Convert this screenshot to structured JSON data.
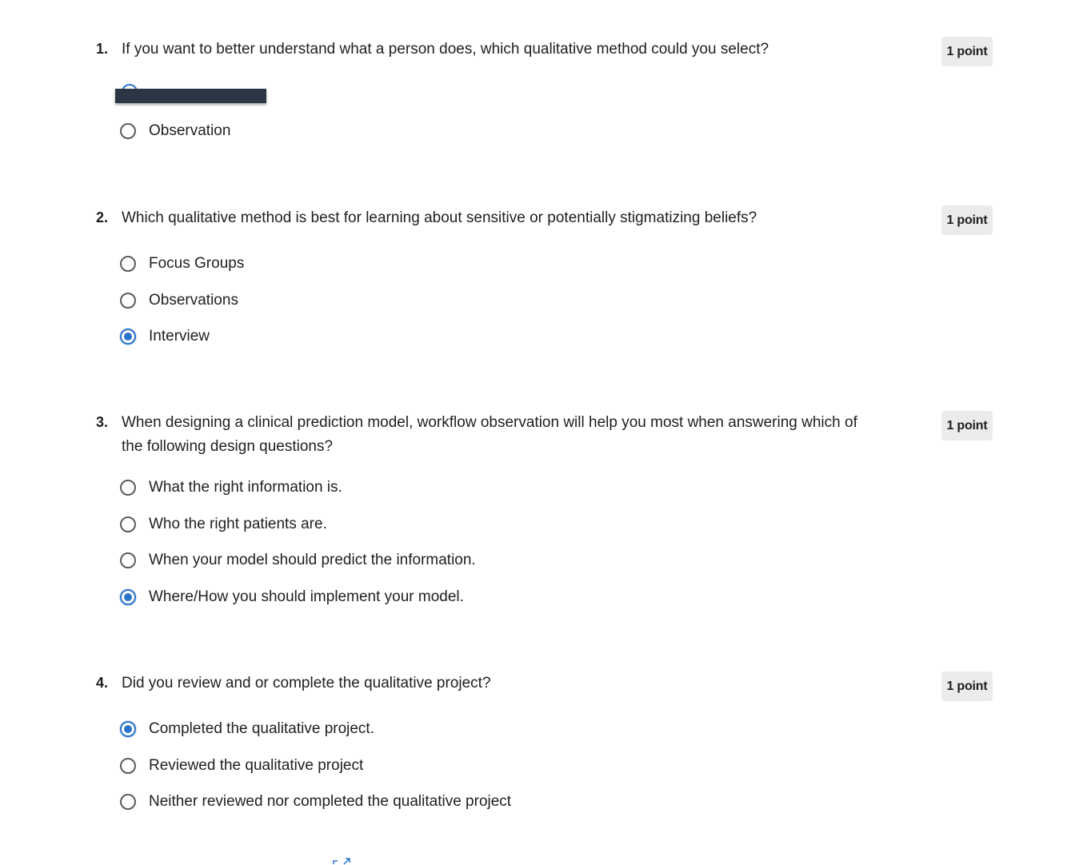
{
  "colors": {
    "accent": "#2a73cc",
    "badge_bg": "#ebebeb",
    "redaction": "#2b3544"
  },
  "questions": [
    {
      "number": "1.",
      "text": "If you want to better understand what a person does, which qualitative method could you select?",
      "points": "1 point",
      "options": [
        {
          "label": "",
          "selected": true,
          "redacted": true
        },
        {
          "label": "Observation",
          "selected": false
        }
      ]
    },
    {
      "number": "2.",
      "text": "Which qualitative method is best for learning about sensitive or potentially stigmatizing beliefs?",
      "points": "1 point",
      "options": [
        {
          "label": "Focus Groups",
          "selected": false
        },
        {
          "label": "Observations",
          "selected": false
        },
        {
          "label": "Interview",
          "selected": true
        }
      ]
    },
    {
      "number": "3.",
      "text": "When designing a clinical prediction model, workflow observation will help you most when answering which of the following design questions?",
      "points": "1 point",
      "options": [
        {
          "label": "What the right information is.",
          "selected": false
        },
        {
          "label": "Who the right patients are.",
          "selected": false
        },
        {
          "label": "When your model should predict the information.",
          "selected": false
        },
        {
          "label": "Where/How you should implement your model.",
          "selected": true
        }
      ]
    },
    {
      "number": "4.",
      "text": "Did you review and or complete the qualitative project?",
      "points": "1 point",
      "options": [
        {
          "label": "Completed the qualitative project.",
          "selected": true
        },
        {
          "label": "Reviewed the qualitative project",
          "selected": false
        },
        {
          "label": "Neither reviewed nor completed the qualitative project",
          "selected": false
        }
      ]
    }
  ],
  "footer": {
    "link_icon": "external-link-icon"
  }
}
